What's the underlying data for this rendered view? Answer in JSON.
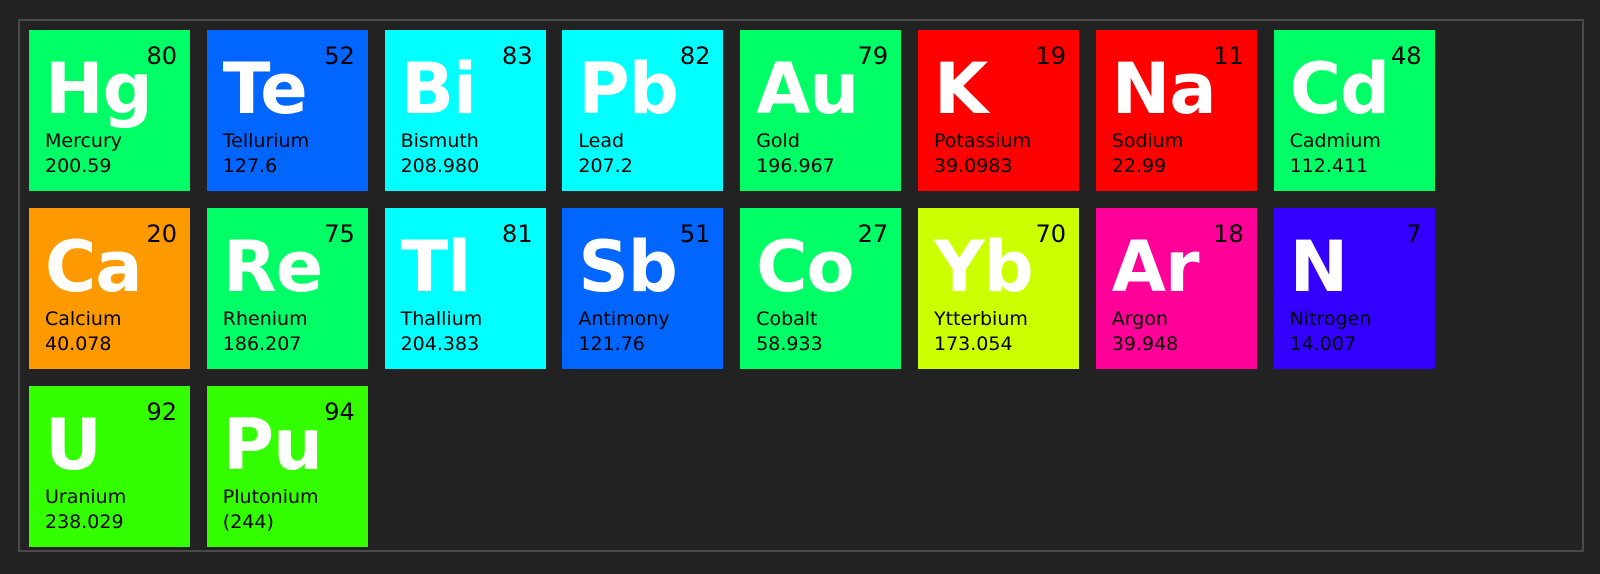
{
  "elements": [
    {
      "symbol": "Hg",
      "number": "80",
      "name": "Mercury",
      "mass": "200.59",
      "color": "#00ff66"
    },
    {
      "symbol": "Te",
      "number": "52",
      "name": "Tellurium",
      "mass": "127.6",
      "color": "#0066ff"
    },
    {
      "symbol": "Bi",
      "number": "83",
      "name": "Bismuth",
      "mass": "208.980",
      "color": "#00ffff"
    },
    {
      "symbol": "Pb",
      "number": "82",
      "name": "Lead",
      "mass": "207.2",
      "color": "#00ffff"
    },
    {
      "symbol": "Au",
      "number": "79",
      "name": "Gold",
      "mass": "196.967",
      "color": "#00ff66"
    },
    {
      "symbol": "K",
      "number": "19",
      "name": "Potassium",
      "mass": "39.0983",
      "color": "#ff0000"
    },
    {
      "symbol": "Na",
      "number": "11",
      "name": "Sodium",
      "mass": "22.99",
      "color": "#ff0000"
    },
    {
      "symbol": "Cd",
      "number": "48",
      "name": "Cadmium",
      "mass": "112.411",
      "color": "#00ff66"
    },
    {
      "symbol": "Ca",
      "number": "20",
      "name": "Calcium",
      "mass": "40.078",
      "color": "#ff9900"
    },
    {
      "symbol": "Re",
      "number": "75",
      "name": "Rhenium",
      "mass": "186.207",
      "color": "#00ff66"
    },
    {
      "symbol": "Tl",
      "number": "81",
      "name": "Thallium",
      "mass": "204.383",
      "color": "#00ffff"
    },
    {
      "symbol": "Sb",
      "number": "51",
      "name": "Antimony",
      "mass": "121.76",
      "color": "#0066ff"
    },
    {
      "symbol": "Co",
      "number": "27",
      "name": "Cobalt",
      "mass": "58.933",
      "color": "#00ff66"
    },
    {
      "symbol": "Yb",
      "number": "70",
      "name": "Ytterbium",
      "mass": "173.054",
      "color": "#ccff00"
    },
    {
      "symbol": "Ar",
      "number": "18",
      "name": "Argon",
      "mass": "39.948",
      "color": "#ff0099"
    },
    {
      "symbol": "N",
      "number": "7",
      "name": "Nitrogen",
      "mass": "14.007",
      "color": "#3300ff"
    },
    {
      "symbol": "U",
      "number": "92",
      "name": "Uranium",
      "mass": "238.029",
      "color": "#33ff00"
    },
    {
      "symbol": "Pu",
      "number": "94",
      "name": "Plutonium",
      "mass": "(244)",
      "color": "#33ff00"
    }
  ]
}
